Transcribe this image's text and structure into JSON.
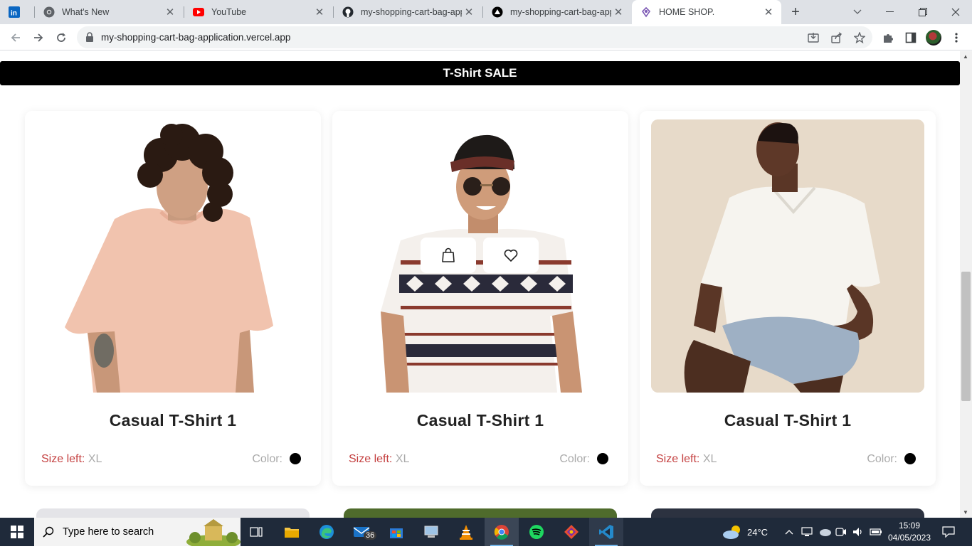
{
  "browser": {
    "tabs": [
      {
        "title": "",
        "icon": "linkedin-icon"
      },
      {
        "title": "What's New",
        "icon": "chrome-icon"
      },
      {
        "title": "YouTube",
        "icon": "youtube-icon"
      },
      {
        "title": "my-shopping-cart-bag-app",
        "icon": "github-icon"
      },
      {
        "title": "my-shopping-cart-bag-app",
        "icon": "vercel-icon"
      },
      {
        "title": "HOME SHOP.",
        "icon": "shop-icon",
        "active": true
      }
    ],
    "url": "my-shopping-cart-bag-application.vercel.app"
  },
  "page": {
    "banner": "T-Shirt SALE",
    "products": [
      {
        "name": "Casual T-Shirt 1",
        "size_label": "Size left:",
        "size_value": "XL",
        "color_label": "Color:",
        "color": "#000000",
        "image": "man-curly-hair-peach-tshirt"
      },
      {
        "name": "Casual T-Shirt 1",
        "size_label": "Size left:",
        "size_value": "XL",
        "color_label": "Color:",
        "color": "#000000",
        "image": "man-sunglasses-patterned-tshirt"
      },
      {
        "name": "Casual T-Shirt 1",
        "size_label": "Size left:",
        "size_value": "XL",
        "color_label": "Color:",
        "color": "#000000",
        "image": "man-white-polo-sitting"
      }
    ]
  },
  "taskbar": {
    "search_placeholder": "Type here to search",
    "mail_badge": "36",
    "temperature": "24°C",
    "time": "15:09",
    "date": "04/05/2023"
  },
  "colors": {
    "banner_bg": "#000000",
    "size_label": "#c44040",
    "taskbar_bg": "#1f2a3a"
  }
}
